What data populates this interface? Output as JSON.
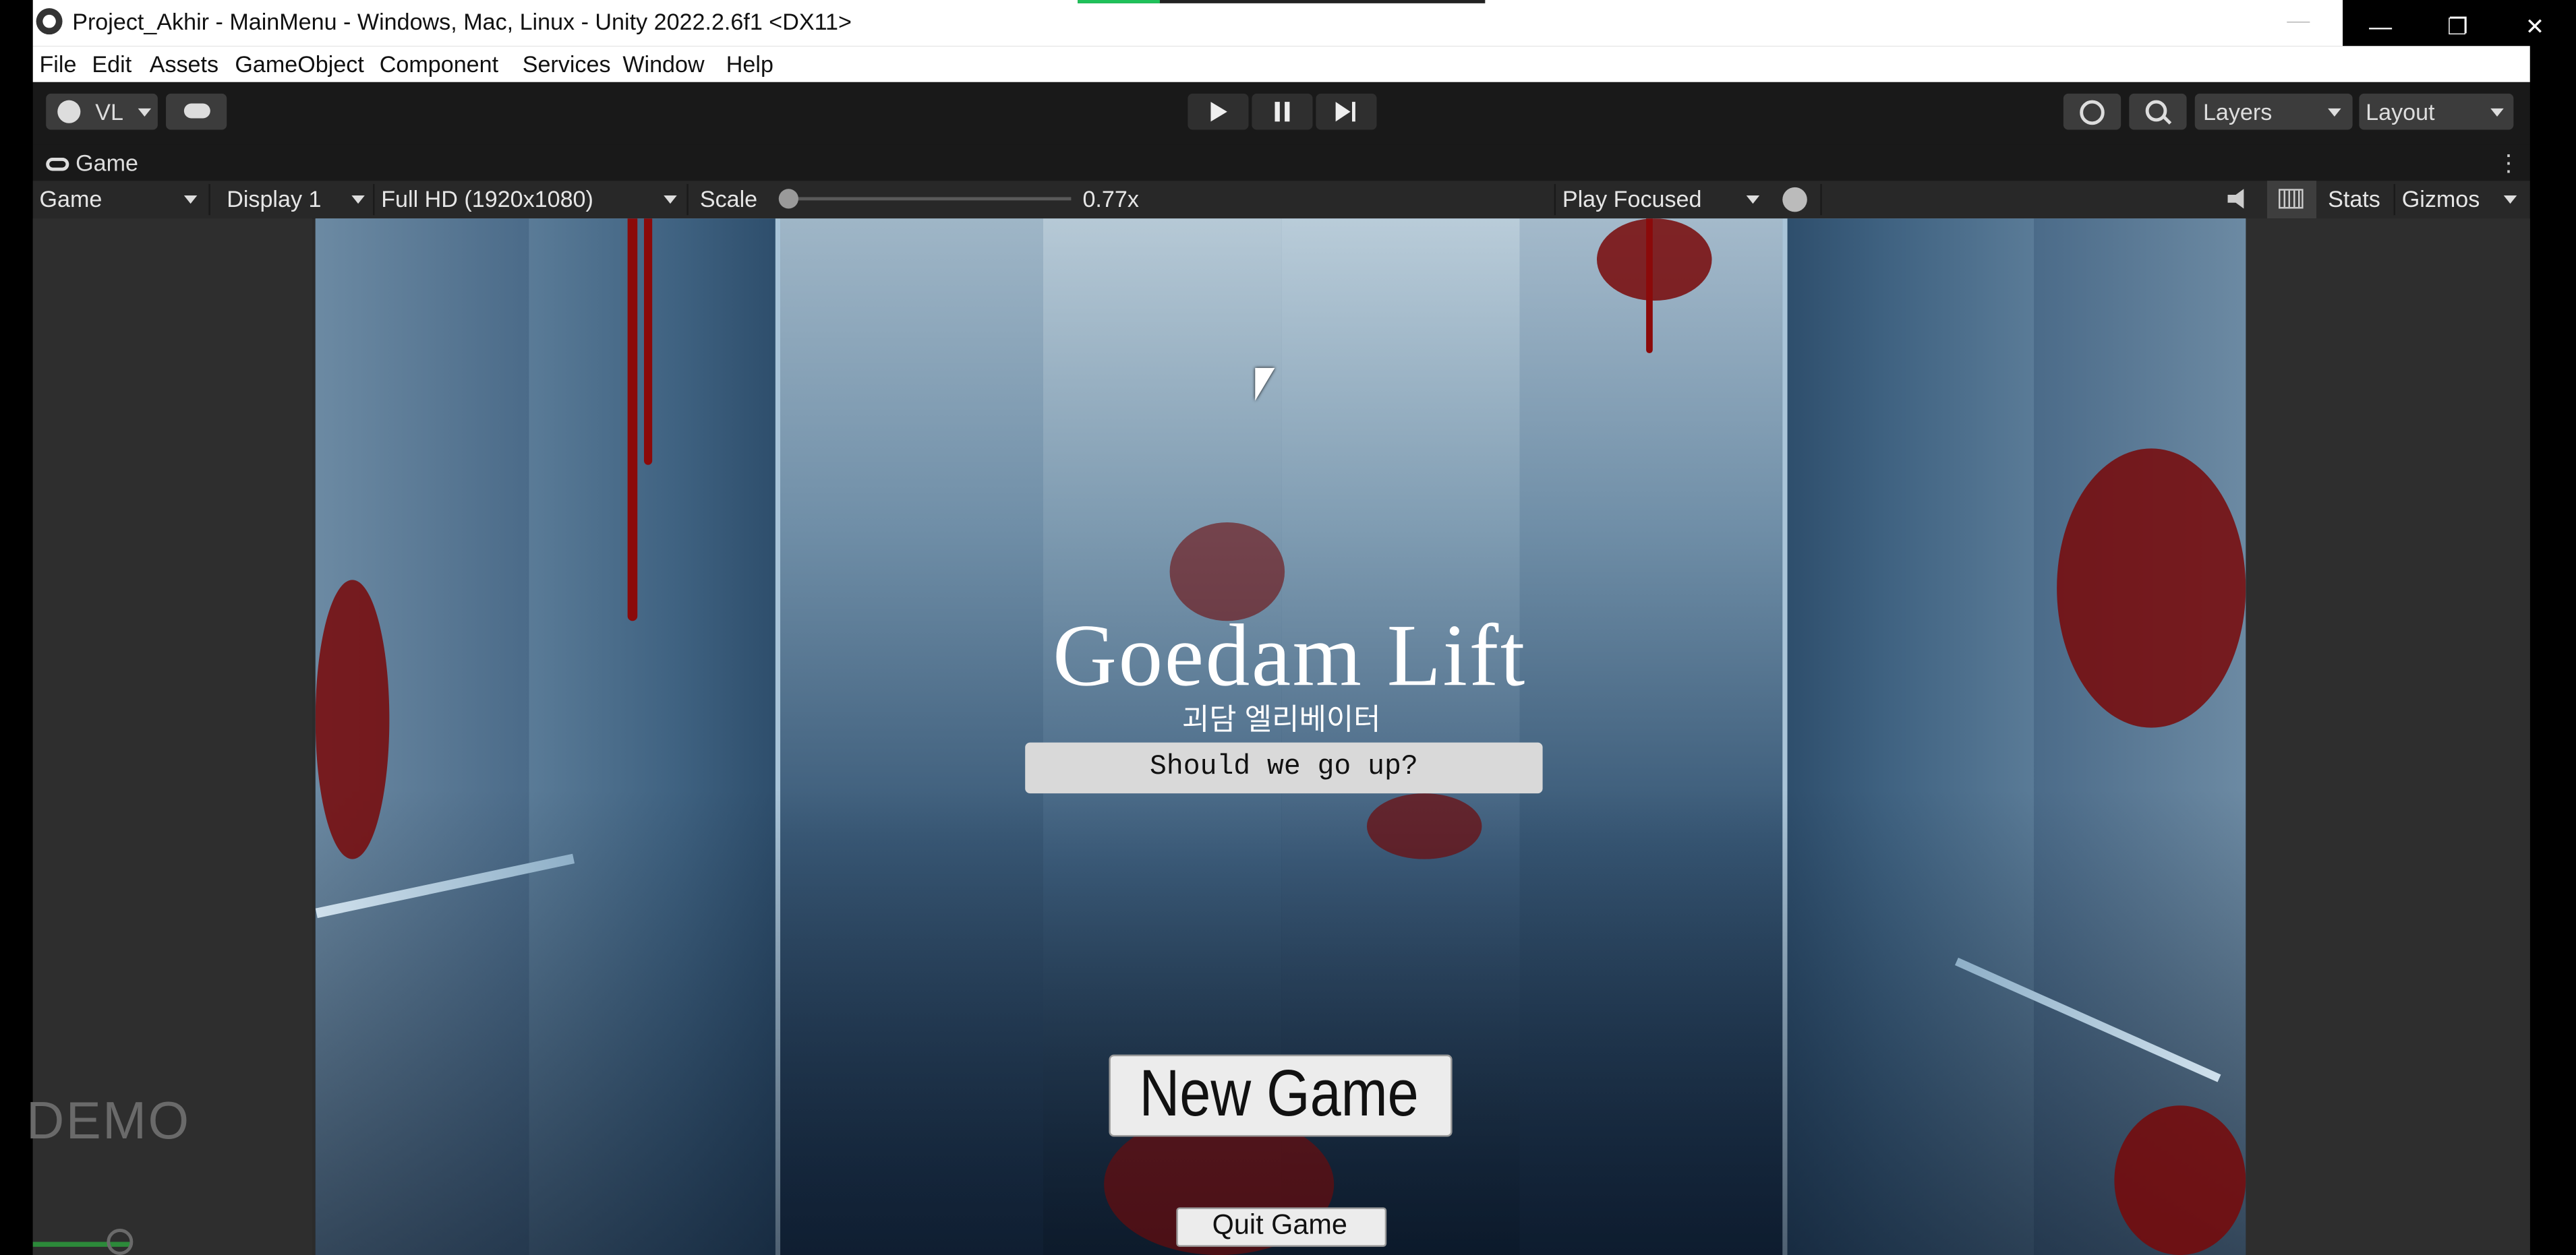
{
  "window": {
    "title": "Project_Akhir - MainMenu - Windows, Mac, Linux - Unity 2022.2.6f1 <DX11>",
    "controls": {
      "minimize": "—",
      "restore": "❐",
      "close": "✕"
    }
  },
  "menu": {
    "items": [
      "File",
      "Edit",
      "Assets",
      "GameObject",
      "Component",
      "Services",
      "Window",
      "Help"
    ]
  },
  "toolbar": {
    "account_label": "VL",
    "layers_label": "Layers",
    "layout_label": "Layout",
    "icons": {
      "account": "account-icon",
      "cloud": "cloud-icon",
      "play": "play-icon",
      "pause": "pause-icon",
      "step": "step-icon",
      "history": "history-icon",
      "search": "search-icon"
    }
  },
  "game_view": {
    "tab_label": "Game",
    "view_select": "Game",
    "display_select": "Display 1",
    "resolution_select": "Full HD (1920x1080)",
    "scale_label": "Scale",
    "scale_value": "0.77x",
    "scale_fraction": 0.0,
    "play_mode_select": "Play Focused",
    "stats_label": "Stats",
    "gizmos_label": "Gizmos"
  },
  "game": {
    "title": "Goedam Lift",
    "subtitle": "괴담 엘리베이터",
    "prompt": "Should we go up?",
    "new_game": "New Game",
    "quit_game": "Quit Game"
  },
  "overlay": {
    "watermark": "DEMO"
  },
  "colors": {
    "editor_dark": "#191919",
    "editor_panel": "#282828",
    "blood": "#8b0a0a",
    "button_bg": "#ececec"
  }
}
